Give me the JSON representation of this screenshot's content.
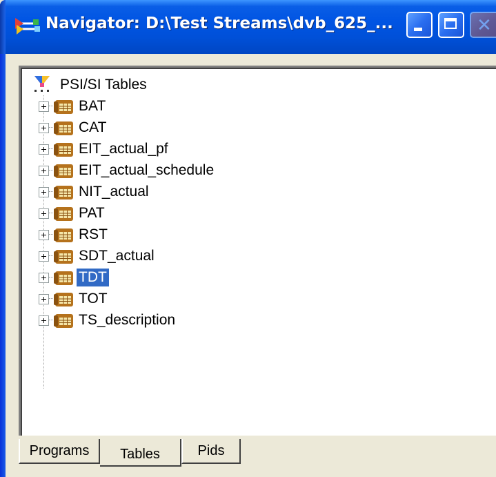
{
  "window": {
    "title": "Navigator: D:\\Test Streams\\dvb_625_...",
    "title_bar_color": "#0054e3",
    "icons": {
      "app": "navigator-app-icon",
      "minimize": "minimize-icon",
      "maximize": "maximize-icon",
      "close": "close-icon"
    }
  },
  "tree": {
    "root": {
      "label": "PSI/SI Tables",
      "icon": "psi-si-tables-icon"
    },
    "items": [
      {
        "label": "BAT",
        "icon": "table-icon",
        "selected": false
      },
      {
        "label": "CAT",
        "icon": "table-icon",
        "selected": false
      },
      {
        "label": "EIT_actual_pf",
        "icon": "table-icon",
        "selected": false
      },
      {
        "label": "EIT_actual_schedule",
        "icon": "table-icon",
        "selected": false
      },
      {
        "label": "NIT_actual",
        "icon": "table-icon",
        "selected": false
      },
      {
        "label": "PAT",
        "icon": "table-icon",
        "selected": false
      },
      {
        "label": "RST",
        "icon": "table-icon",
        "selected": false
      },
      {
        "label": "SDT_actual",
        "icon": "table-icon",
        "selected": false
      },
      {
        "label": "TDT",
        "icon": "table-icon",
        "selected": true
      },
      {
        "label": "TOT",
        "icon": "table-icon",
        "selected": false
      },
      {
        "label": "TS_description",
        "icon": "table-icon",
        "selected": false
      }
    ],
    "selection_color": "#316ac5"
  },
  "tabs": [
    {
      "label": "Programs",
      "active": false
    },
    {
      "label": "Tables",
      "active": true
    },
    {
      "label": "Pids",
      "active": false
    }
  ]
}
